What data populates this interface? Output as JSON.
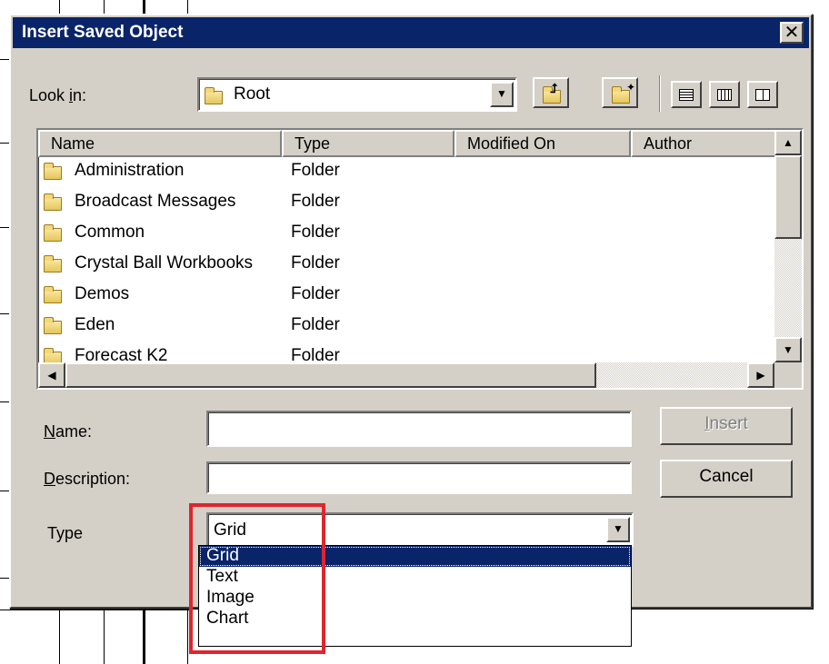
{
  "dialog": {
    "title": "Insert Saved Object",
    "close_label": "✕"
  },
  "look_in": {
    "label_pre": "Look ",
    "label_key": "i",
    "label_post": "n:",
    "value": "Root"
  },
  "file_list": {
    "columns": [
      "Name",
      "Type",
      "Modified On",
      "Author"
    ],
    "rows": [
      {
        "name": "Administration",
        "type": "Folder"
      },
      {
        "name": "Broadcast Messages",
        "type": "Folder"
      },
      {
        "name": "Common",
        "type": "Folder"
      },
      {
        "name": "Crystal Ball Workbooks",
        "type": "Folder"
      },
      {
        "name": "Demos",
        "type": "Folder"
      },
      {
        "name": "Eden",
        "type": "Folder"
      },
      {
        "name": "Forecast K2",
        "type": "Folder"
      }
    ]
  },
  "form": {
    "name_key": "N",
    "name_rest": "ame:",
    "name_value": "",
    "description_key": "D",
    "description_rest": "escription:",
    "description_value": "",
    "type_label": "Type",
    "type_value": "Grid",
    "type_options": [
      "Grid",
      "Text",
      "Image",
      "Chart"
    ],
    "type_selected": "Grid"
  },
  "buttons": {
    "insert_key": "I",
    "insert_rest": "nsert",
    "cancel": "Cancel"
  },
  "icons": {
    "dropdown_arrow": "▼",
    "scroll_up": "▲",
    "scroll_down": "▼",
    "scroll_left": "◀",
    "scroll_right": "▶"
  },
  "colors": {
    "titlebar": "#0a246a",
    "highlight_box": "#e0252d"
  }
}
